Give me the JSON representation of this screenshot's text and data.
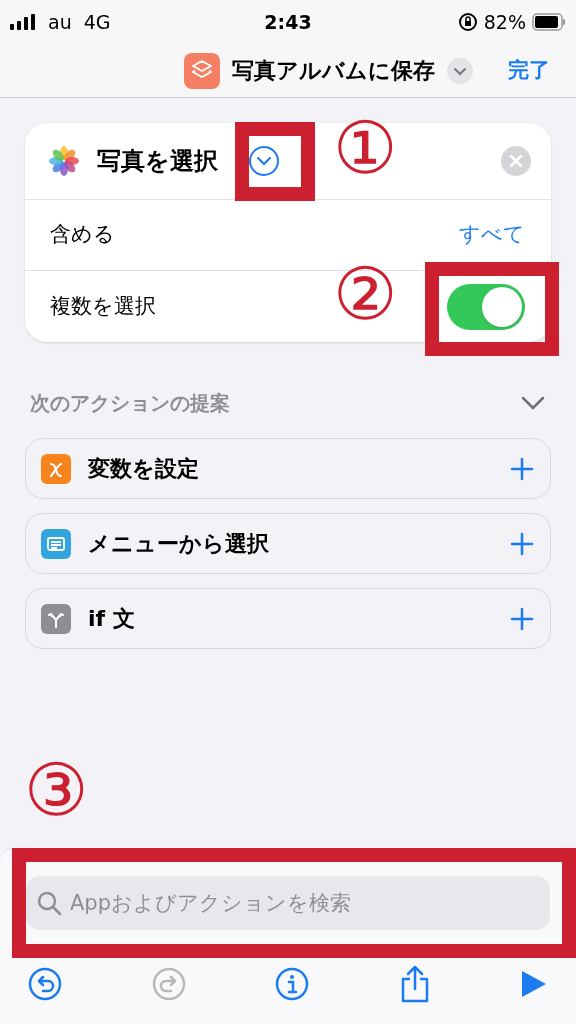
{
  "status_bar": {
    "carrier": "au",
    "network": "4G",
    "time": "2:43",
    "battery": "82%"
  },
  "nav_bar": {
    "title": "写真アルバムに保存",
    "done": "完了"
  },
  "action_card": {
    "title": "写真を選択",
    "params": [
      {
        "kind": "value",
        "label": "含める",
        "value": "すべて"
      },
      {
        "kind": "toggle",
        "label": "複数を選択",
        "on": true
      }
    ]
  },
  "suggestions": {
    "title": "次のアクションの提案",
    "items": [
      {
        "kind": "variable",
        "label": "変数を設定",
        "color": "#f7831c"
      },
      {
        "kind": "menu",
        "label": "メニューから選択",
        "color": "#34a6de"
      },
      {
        "kind": "if",
        "label": "if 文",
        "color": "#8e8e93"
      }
    ]
  },
  "search": {
    "placeholder": "Appおよびアクションを検索"
  },
  "toolbar": [
    {
      "kind": "undo",
      "disabled": false
    },
    {
      "kind": "redo",
      "disabled": true
    },
    {
      "kind": "info",
      "disabled": false
    },
    {
      "kind": "share",
      "disabled": false
    },
    {
      "kind": "run",
      "disabled": false
    }
  ],
  "annotations": [
    {
      "label": "①"
    },
    {
      "label": "②"
    },
    {
      "label": "③"
    }
  ]
}
